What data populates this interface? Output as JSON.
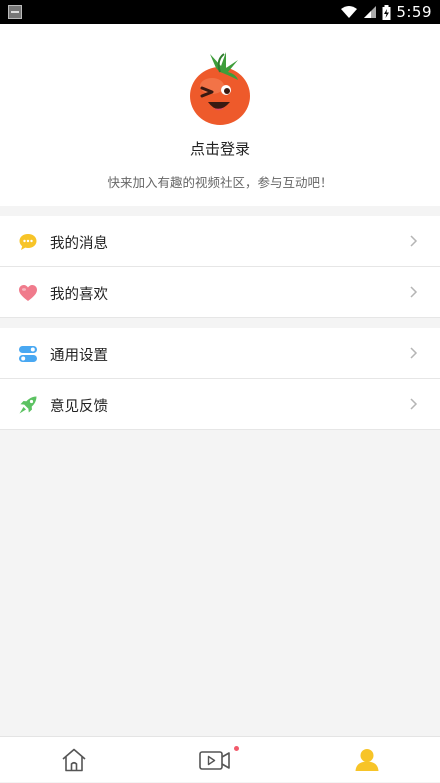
{
  "status_bar": {
    "time": "5:59",
    "wifi_icon": "wifi-icon",
    "signal_icon": "signal-icon",
    "battery_icon": "battery-charging-icon"
  },
  "profile": {
    "avatar_icon": "tomato-mascot-icon",
    "login_label": "点击登录",
    "subtitle": "快来加入有趣的视频社区，参与互动吧！"
  },
  "menu": {
    "groups": [
      {
        "items": [
          {
            "icon": "message-bubble-icon",
            "label": "我的消息",
            "color": "#f7c428"
          },
          {
            "icon": "heart-icon",
            "label": "我的喜欢",
            "color": "#f07b8c"
          }
        ]
      },
      {
        "items": [
          {
            "icon": "settings-toggle-icon",
            "label": "通用设置",
            "color": "#49a8f2"
          },
          {
            "icon": "rocket-icon",
            "label": "意见反馈",
            "color": "#5cc262"
          }
        ]
      }
    ]
  },
  "tabbar": {
    "tabs": [
      {
        "icon": "home-icon",
        "active": false
      },
      {
        "icon": "video-camera-icon",
        "active": false,
        "badge": true
      },
      {
        "icon": "user-icon",
        "active": true
      }
    ],
    "active_color": "#f7c428",
    "badge_color": "#f25a6b"
  }
}
